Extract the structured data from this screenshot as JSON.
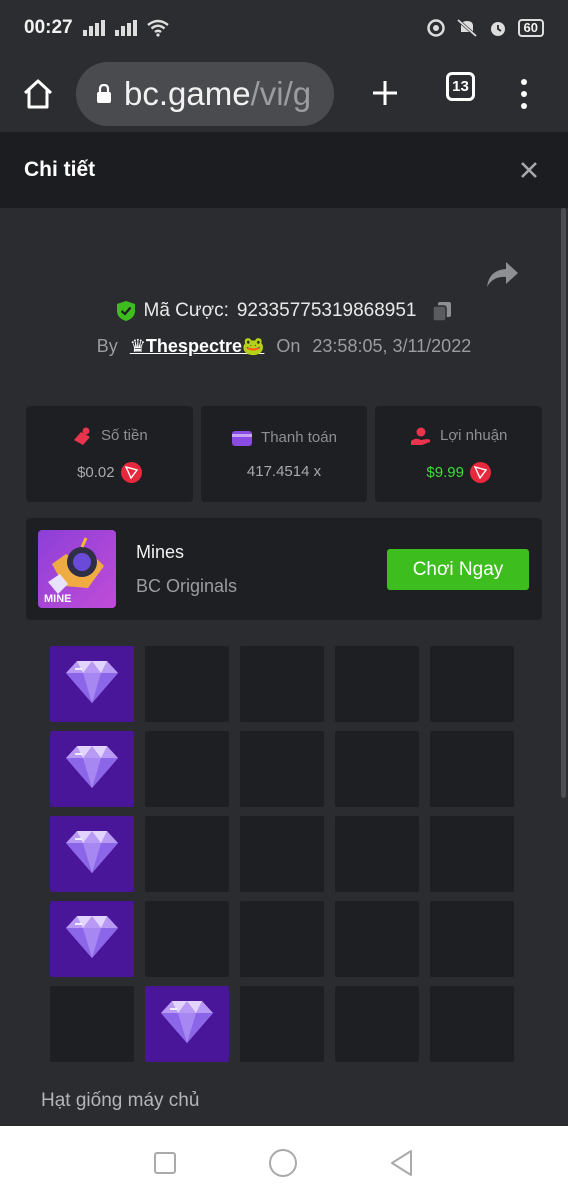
{
  "status_bar": {
    "time": "00:27",
    "battery": "60"
  },
  "browser": {
    "url_host": "bc.game",
    "url_path": "/vi/g",
    "tab_count": "13"
  },
  "modal": {
    "title": "Chi tiết"
  },
  "bet": {
    "id_label": "Mã Cược:",
    "id_value": "92335775319868951",
    "by_label": "By",
    "username": "♛Thespectre🐸",
    "on_label": "On",
    "datetime": "23:58:05, 3/11/2022"
  },
  "stats": [
    {
      "label": "Số tiền",
      "value": "$0.02",
      "icon": "money-bag-icon",
      "icon_color": "#e8344c"
    },
    {
      "label": "Thanh toán",
      "value": "417.4514 x",
      "icon": "wallet-icon",
      "icon_color": "#8a4be0"
    },
    {
      "label": "Lợi nhuận",
      "value": "$9.99",
      "icon": "hand-coin-icon",
      "icon_color": "#e8344c"
    }
  ],
  "game": {
    "thumb_text": "MINE",
    "name": "Mines",
    "provider": "BC Originals",
    "play_label": "Chơi Ngay"
  },
  "mines_grid": {
    "rows": 5,
    "cols": 5,
    "gems": [
      [
        0,
        0
      ],
      [
        1,
        0
      ],
      [
        2,
        0
      ],
      [
        3,
        0
      ],
      [
        4,
        1
      ]
    ]
  },
  "seed_label": "Hạt giống máy chủ",
  "colors": {
    "accent_green": "#3ebd1e",
    "profit_green": "#3fdc3c",
    "gem_purple": "#4a1699",
    "trx_red": "#e8283c"
  }
}
